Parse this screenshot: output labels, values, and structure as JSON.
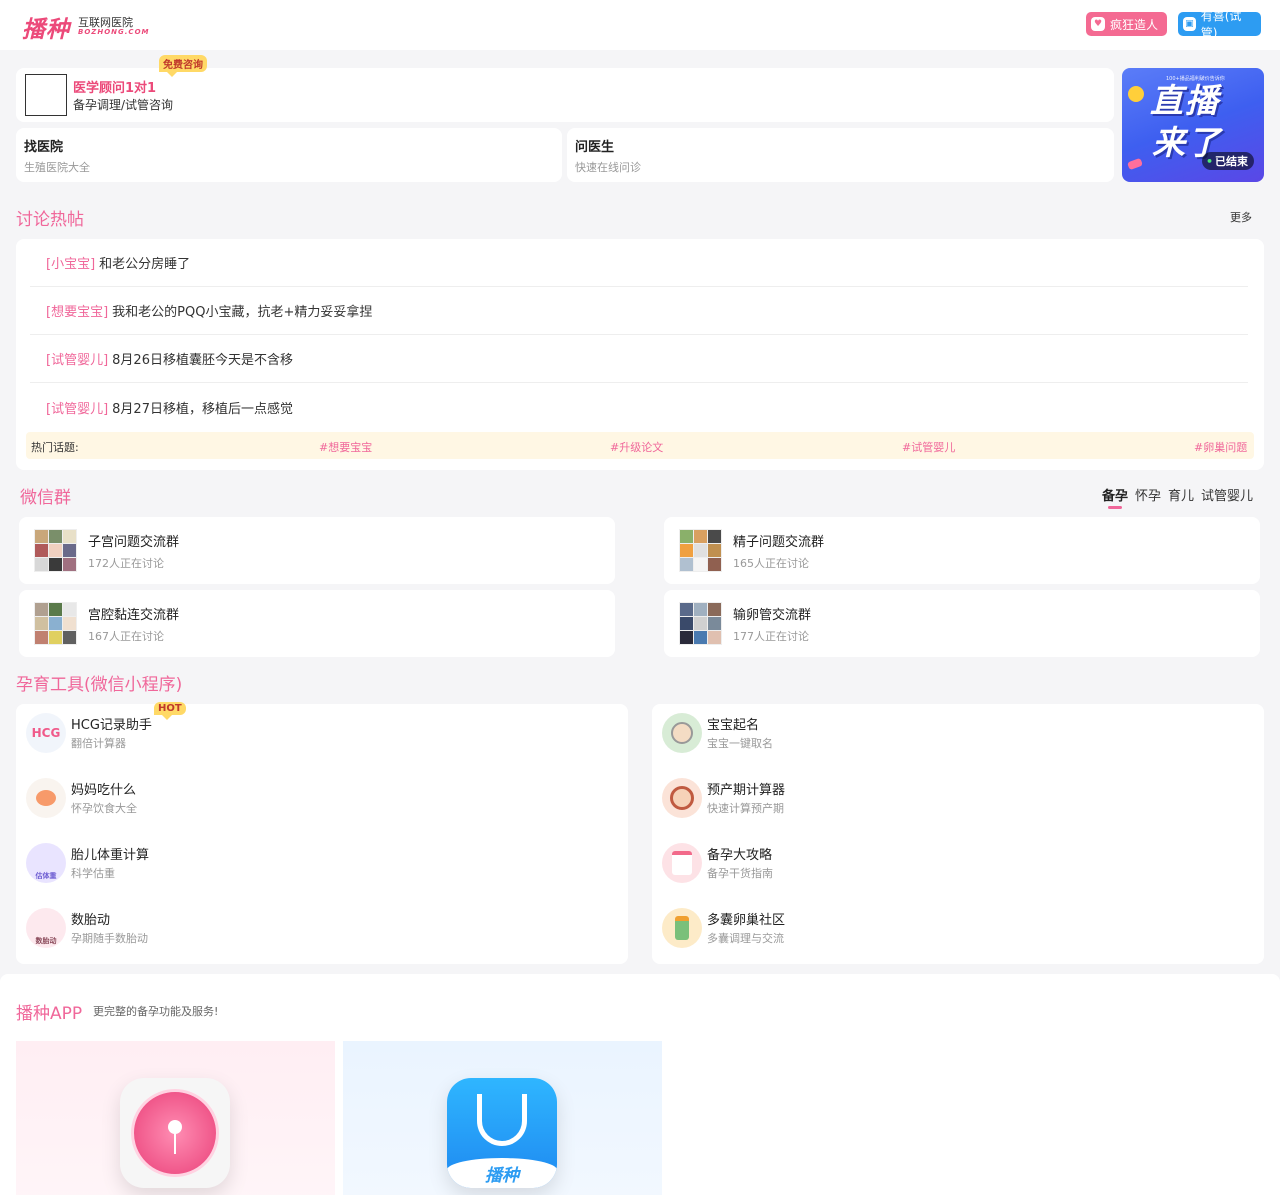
{
  "header": {
    "logo_main": "播种",
    "logo_sub1": "互联网医院",
    "logo_sub2": "BOZHONG.COM",
    "btn_pink": "疯狂造人",
    "btn_blue": "有喜(试管)"
  },
  "consult": {
    "badge": "免费咨询",
    "title": "医学顾问1对1",
    "subtitle": "备孕调理/试管咨询"
  },
  "find_hospital": {
    "title": "找医院",
    "subtitle": "生殖医院大全"
  },
  "ask_doctor": {
    "title": "问医生",
    "subtitle": "快速在线问诊"
  },
  "live": {
    "sub": "100+播品福利破价告诉你",
    "line1": "直播",
    "line2": "来了",
    "status": "已结束"
  },
  "discussion": {
    "title": "讨论热帖",
    "more": "更多",
    "posts": [
      {
        "tag": "[小宝宝]",
        "text": "和老公分房睡了"
      },
      {
        "tag": "[想要宝宝]",
        "text": "我和老公的PQQ小宝藏，抗老+精力妥妥拿捏"
      },
      {
        "tag": "[试管婴儿]",
        "text": "8月26日移植囊胚今天是不含移"
      },
      {
        "tag": "[试管婴儿]",
        "text": "8月27日移植，移植后一点感觉"
      }
    ],
    "hot_label": "热门话题:",
    "hot_topics": [
      "#想要宝宝",
      "#升级论文",
      "#试管婴儿",
      "#卵巢问题"
    ]
  },
  "wechat": {
    "title": "微信群",
    "tabs": [
      "备孕",
      "怀孕",
      "育儿",
      "试管婴儿"
    ],
    "groups": [
      {
        "name": "子宫问题交流群",
        "count": "172人正在讨论"
      },
      {
        "name": "精子问题交流群",
        "count": "165人正在讨论"
      },
      {
        "name": "宫腔黏连交流群",
        "count": "167人正在讨论"
      },
      {
        "name": "输卵管交流群",
        "count": "177人正在讨论"
      }
    ]
  },
  "tools": {
    "title": "孕育工具(微信小程序)",
    "hot_badge": "HOT",
    "left": [
      {
        "name": "HCG记录助手",
        "desc": "翻倍计算器",
        "icon": "hcg-icon",
        "icon_text": "HCG",
        "color": "#f1f5fb"
      },
      {
        "name": "妈妈吃什么",
        "desc": "怀孕饮食大全",
        "icon": "peach-icon",
        "color": "#f9f4ef"
      },
      {
        "name": "胎儿体重计算",
        "desc": "科学估重",
        "icon": "baby-icon",
        "icon_text": "估体重",
        "color": "#e9e4ff"
      },
      {
        "name": "数胎动",
        "desc": "孕期随手数胎动",
        "icon": "mother-icon",
        "icon_text": "数胎动",
        "color": "#fde9ee"
      }
    ],
    "right": [
      {
        "name": "宝宝起名",
        "desc": "宝宝一键取名",
        "icon": "old-man-icon",
        "color": "#d8ecd6"
      },
      {
        "name": "预产期计算器",
        "desc": "快速计算预产期",
        "icon": "girl-icon",
        "color": "#fbe3d8"
      },
      {
        "name": "备孕大攻略",
        "desc": "备孕干货指南",
        "icon": "notebook-icon",
        "color": "#fde2e6"
      },
      {
        "name": "多囊卵巢社区",
        "desc": "多囊调理与交流",
        "icon": "bottle-icon",
        "color": "#fdebc8"
      }
    ]
  },
  "app": {
    "title": "播种APP",
    "subtitle": "更完整的备孕功能及服务!",
    "app_label": "播种"
  },
  "colors": {
    "accent_pink": "#f0679a",
    "accent_blue": "#2d9cf2",
    "hot_bg": "#fff7e4"
  }
}
